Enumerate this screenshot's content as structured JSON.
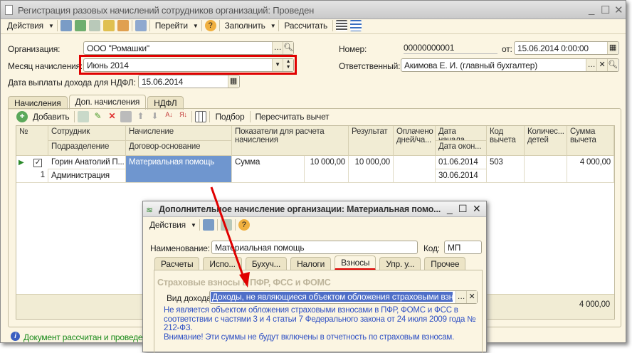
{
  "window": {
    "title": "Регистрация разовых начислений сотрудников организаций: Проведен"
  },
  "toolbar": {
    "actions": "Действия",
    "goto": "Перейти",
    "fill": "Заполнить",
    "calculate": "Рассчитать"
  },
  "form": {
    "org_label": "Организация:",
    "org_value": "ООО \"Ромашки\"",
    "month_label": "Месяц начисления:",
    "month_value": "Июнь 2014",
    "ndfl_date_label": "Дата выплаты дохода для НДФЛ:",
    "ndfl_date_value": "15.06.2014",
    "number_label": "Номер:",
    "number_value": "00000000001",
    "from_label": "от:",
    "from_value": "15.06.2014  0:00:00",
    "resp_label": "Ответственный:",
    "resp_value": "Акимова Е. И. (главный бухгалтер)"
  },
  "tabs": [
    "Начисления",
    "Доп. начисления",
    "НДФЛ"
  ],
  "active_tab": "Доп. начисления",
  "grid_toolbar": {
    "add": "Добавить",
    "pick": "Подбор",
    "recalc": "Пересчитать вычет"
  },
  "grid": {
    "headers": {
      "no": "№",
      "employee": "Сотрудник",
      "department": "Подразделение",
      "accrual": "Начисление",
      "contract": "Договор-основание",
      "indicators": "Показатели для расчета начисления",
      "result": "Результат",
      "paid": "Оплачено дней/ча...",
      "start": "Дата начала",
      "end": "Дата окон...",
      "code": "Код вычета",
      "children": "Количес... детей",
      "deduction": "Сумма вычета"
    },
    "rows": [
      {
        "no": "1",
        "employee": "Горин Анатолий П...",
        "department": "Администрация",
        "accrual": "Материальная помощь",
        "indicator": "Сумма",
        "indicator_value": "10 000,00",
        "result": "10 000,00",
        "start": "01.06.2014",
        "end": "30.06.2014",
        "code": "503",
        "deduction": "4 000,00"
      }
    ],
    "total_deduction": "4 000,00"
  },
  "status": "Документ рассчитан и проведен",
  "dialog": {
    "title": "Дополнительное начисление организации: Материальная помо...",
    "actions": "Действия",
    "name_label": "Наименование:",
    "name_value": "Материальная помощь",
    "code_label": "Код:",
    "code_value": "МП",
    "tabs": [
      "Расчеты",
      "Испо...",
      "Бухуч...",
      "Налоги",
      "Взносы",
      "Упр. у...",
      "Прочее"
    ],
    "active_tab": "Взносы",
    "section": "Страховые взносы в ПФР, ФСС и ФОМС",
    "income_label": "Вид дохода:",
    "income_value": "Доходы, не являющиеся объектом обложения страховыми взнос",
    "note1": "Не является объектом обложения страховыми взносами в ПФР, ФОМС и ФСС в соответствии с частями 3 и 4 статьи 7 Федерального закона от 24 июля 2009 года № 212-ФЗ.",
    "note2": "Внимание! Эти суммы не будут включены в отчетность по страховым взносам."
  },
  "colors": {
    "highlight": "#e00000",
    "selection": "#6f96cf",
    "info": "#2d4fc4",
    "status": "#1a8a1a",
    "bg": "#fbf5e2"
  }
}
